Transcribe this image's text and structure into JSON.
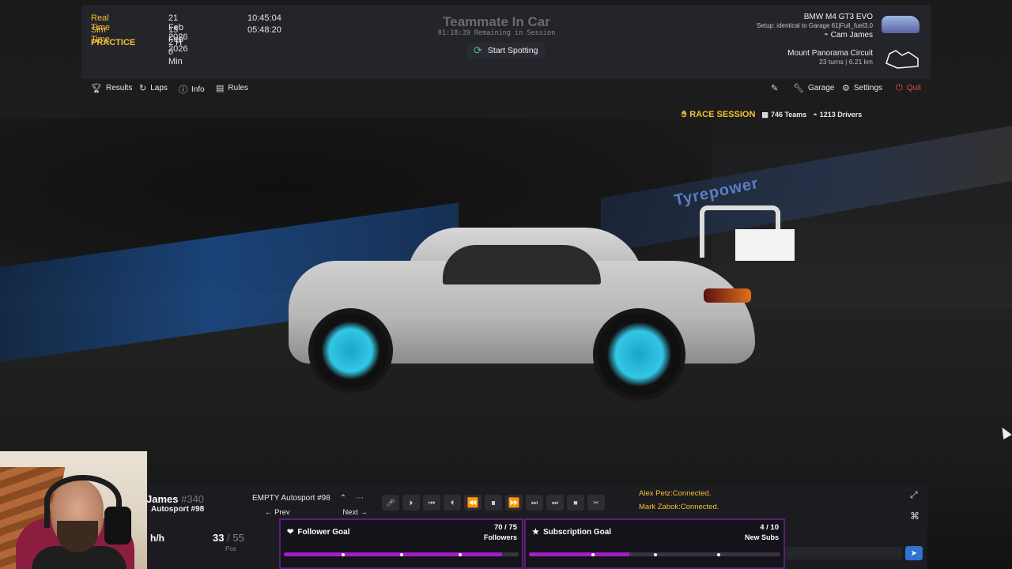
{
  "session": {
    "real_time_label": "Real Time",
    "real_time_date": "21 Feb 2026",
    "real_time_clock": "10:45:04",
    "sim_time_label": "Sim Time",
    "sim_time_date": "15 Feb 2026",
    "sim_time_clock": "05:48:20",
    "type_label": "PRACTICE",
    "duration": "2 H 0 Min"
  },
  "status": {
    "title": "Teammate In Car",
    "remaining": "01:18:39 Remaining in Session",
    "spot_button": "Start Spotting"
  },
  "car": {
    "model": "BMW M4 GT3 EVO",
    "setup": "Setup: identical to Garage 61|Full_fuel3.0",
    "driver": "Cam James"
  },
  "track": {
    "name": "Mount Panorama Circuit",
    "details": "23 turns | 6.21 km"
  },
  "menu": {
    "results": "Results",
    "laps": "Laps",
    "info": "Info",
    "rules": "Rules",
    "garage": "Garage",
    "settings": "Settings",
    "quit": "Quit"
  },
  "race_banner": {
    "label": "RACE SESSION",
    "teams": "746 Teams",
    "drivers": "1213 Drivers"
  },
  "driver_panel": {
    "name": "James",
    "number": "#340",
    "team": "Autosport #98",
    "speed_unit": "h/h",
    "position": "33",
    "position_sep": "/",
    "position_total": "55",
    "position_label": "Pos"
  },
  "camera": {
    "selected": "EMPTY Autosport #98",
    "prev": "Prev",
    "next": "Next"
  },
  "chat": {
    "line1": "Alex Petz:Connected.",
    "line2": "Mark Zabok:Connected."
  },
  "goals": {
    "follower": {
      "title": "Follower Goal",
      "count": "70 / 75",
      "unit": "Followers",
      "progress": 0.93
    },
    "subscription": {
      "title": "Subscription Goal",
      "count": "4 / 10",
      "unit": "New Subs",
      "progress": 0.4
    }
  },
  "colors": {
    "accent_yellow": "#f2c230",
    "quit_red": "#e0514b",
    "goal_purple": "#a31ec9",
    "send_blue": "#2f74d0"
  }
}
